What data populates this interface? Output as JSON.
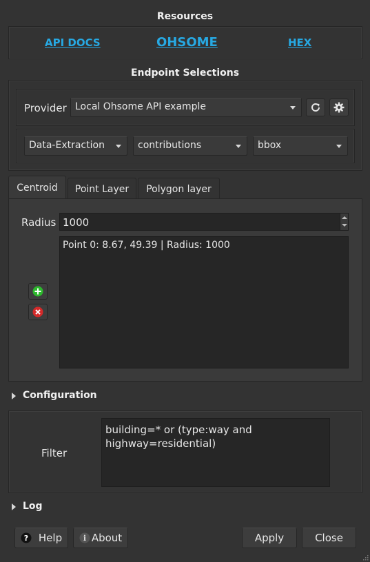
{
  "resources": {
    "title": "Resources",
    "links": [
      "API DOCS",
      "OHSOME",
      "HEX"
    ]
  },
  "endpoint": {
    "title": "Endpoint Selections",
    "provider_label": "Provider",
    "provider_value": "Local Ohsome API example",
    "refresh_icon": "refresh-icon",
    "settings_icon": "gear-icon",
    "combo1": "Data-Extraction",
    "combo2": "contributions",
    "combo3": "bbox"
  },
  "tabs": [
    "Centroid",
    "Point Layer",
    "Polygon layer"
  ],
  "centroid": {
    "radius_label": "Radius",
    "radius_value": "1000",
    "points": [
      "Point 0: 8.67, 49.39 | Radius: 1000"
    ],
    "add_icon": "plus-icon",
    "remove_icon": "close-icon"
  },
  "configuration": {
    "title": "Configuration",
    "filter_label": "Filter",
    "filter_value": "building=* or (type:way and\nhighway=residential)"
  },
  "log": {
    "title": "Log"
  },
  "buttons": {
    "help": "Help",
    "about": "About",
    "apply": "Apply",
    "close": "Close"
  },
  "colors": {
    "background": "#333333",
    "link": "#27a9e3",
    "add_green": "#2db82d",
    "remove_red": "#d42a2a"
  }
}
